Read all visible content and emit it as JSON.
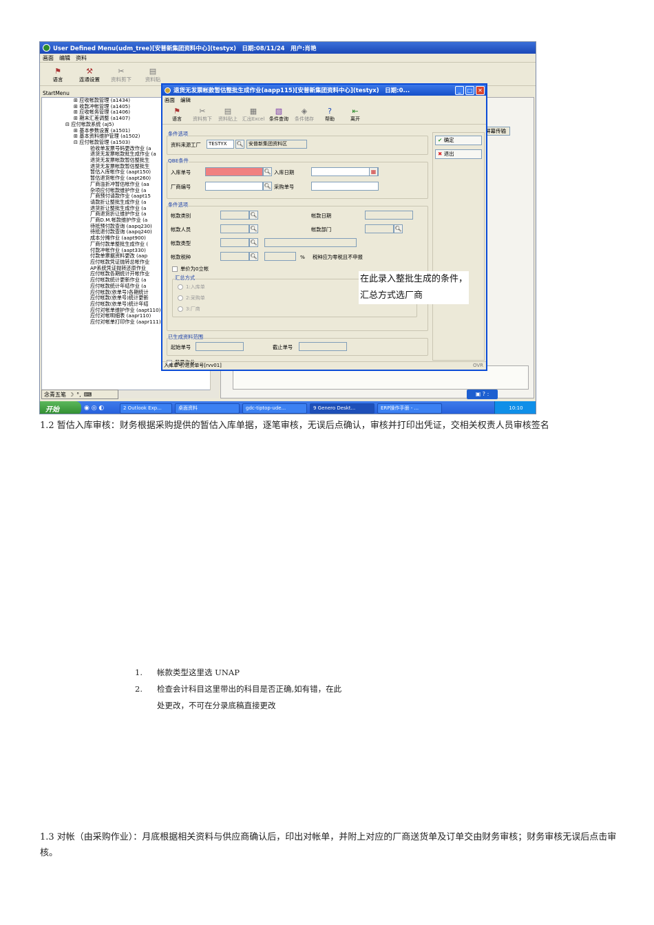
{
  "window": {
    "title": "User Defined Menu(udm_tree)[安普新集团资料中心](testyx)　日期:08/11/24　用户:肖艳",
    "menu": [
      "画面",
      "编辑",
      "资料"
    ],
    "toolbar": [
      {
        "label": "语言",
        "icon": "flag-icon"
      },
      {
        "label": "连通设置",
        "icon": "wand-icon"
      },
      {
        "label": "资料剪下",
        "icon": "scissors-icon"
      },
      {
        "label": "资料贴",
        "icon": "paste-icon"
      }
    ],
    "start_menu_label": "StartMenu",
    "right_button": "屏幕传输"
  },
  "tree": {
    "items_l1": [
      "⊞ 应收帐款管理 (a1434)",
      "⊞ 收款冲帐管理 (a1405)",
      "⊞ 应收帐务管理 (a1406)",
      "⊞ 期末汇差调整 (a1407)"
    ],
    "ap_root": "⊟ 应付帐款系统 (aJ5)",
    "items_l2": [
      "⊞ 基本参数设置 (a1501)",
      "⊞ 基本资料维护管理 (a1502)",
      "⊟ 应付帐款管理 (a1503)"
    ],
    "items_l3": [
      "验收单发票号码更改作业 (a",
      "退货无发票帐款批生成作业 (a",
      "退货无发票帐款暂估整批生",
      "退货无发票帐款暂估整批生",
      "暂估入库帐作业 (aapt150)",
      "暂估退货帐作业 (aapt260)",
      "厂商溢折冲暂估帐作业 (aa",
      "杂项应付帐款维护作业 (a",
      "厂商预付请款作业 (aapt15",
      "请款折让整批生成作业 (a",
      "退货折让整批生成作业 (a",
      "厂商退货折让维护作业 (a",
      "厂商D.M.帐款维护作业 (a",
      "待抵预付款查询 (aapq230)",
      "待抵退付款查询 (aapq240)",
      "成本分摊作业 (aapt900)",
      "厂商付款单整批生成作业 (",
      "付款冲帐作业 (aapt330)",
      "付款单票据资料更改 (aap",
      "应付帐款凭证抛转总帐作业",
      "AP系统凭证抛转还原作业",
      "应付帐款各期统计开帐作业",
      "应付帐款统计更新作业 (a",
      "应付帐款统计年结作业 (a",
      "应付帐款(依单号)各期统计",
      "应付帐款(依单号)统计更新",
      "应付帐款(依单号)统计年结",
      "应付对帐单维护作业 (aapt110)",
      "应付对帐明细表 (aapr110)",
      "应付对帐单打印作业 (aapr111)"
    ]
  },
  "langbar": {
    "text": "念青五笔",
    "icons": [
      "moon-icon",
      "punct-icon",
      "keyboard-icon"
    ]
  },
  "taskbar": {
    "start": "开始",
    "tasks": [
      "2 Outlook Exp...",
      "桌面资料",
      "gdc-tiptop-ude...",
      "9 Genero Deskt...",
      "ERP操作手册 - ..."
    ],
    "clock": "10:10"
  },
  "dialog": {
    "title": "退货无发票帐款暂估整批生成作业(aapp115)[安普新集团资料中心](testyx)　日期:0...",
    "menu": [
      "画面",
      "编辑"
    ],
    "toolbar": [
      "语言",
      "资料剪下",
      "资料贴上",
      "汇出Excel",
      "条件查询",
      "条件储存",
      "帮助",
      "离开"
    ],
    "group1": {
      "title": "条件选项",
      "factory_label": "资料来源工厂",
      "factory_value": "TESTYX",
      "factory_name": "安普新集团资料区"
    },
    "qbe": {
      "title": "QBE条件",
      "receipt_no": "入库单号",
      "receipt_date": "入库日期",
      "vendor_no": "厂商编号",
      "po_no": "采购单号"
    },
    "options": {
      "title": "条件选项",
      "ap_type": "帐款类别",
      "ap_date": "帐款日期",
      "ap_staff": "帐款人员",
      "ap_dept": "帐款部门",
      "ap_kind": "帐款类型",
      "tax_kind": "帐款税种",
      "tax_note": "税种应为零税且不申报",
      "percent": "%",
      "unit_price_zero": "单价为0立帐",
      "summary_title": "汇总方式",
      "summary_options": [
        "1:入库单",
        "2:采购单",
        "3:厂商"
      ]
    },
    "generated": {
      "title": "已生成资料范围",
      "start_no": "起始单号",
      "end_no": "截止单号"
    },
    "copy_job": "背景作业",
    "ok_button": "确定",
    "exit_button": "退出",
    "status_text": "入库单号/退货单号[rvv01]",
    "status_mode": "OVR"
  },
  "annotation": "在此录入整批生成的条件，汇总方式选厂商",
  "doc": {
    "section_1_2": "1.2 暂估入库审核：财务根据采购提供的暂估入库单据，逐笔审核，无误后点确认，审核并打印出凭证，交相关权责人员审核签名",
    "list": [
      {
        "num": "1.",
        "text": "帐款类型这里选 UNAP"
      },
      {
        "num": "2.",
        "text": "检查会计科目这里带出的科目是否正确,如有错，在此处更改，不可在分录底稿直接更改"
      }
    ],
    "section_1_3": "1.3 对帐（由采购作业）：月底根据相关资料与供应商确认后，印出对帐单，并附上对应的厂商送货单及订单交由财务审核；财务审核无误后点击审核。"
  }
}
